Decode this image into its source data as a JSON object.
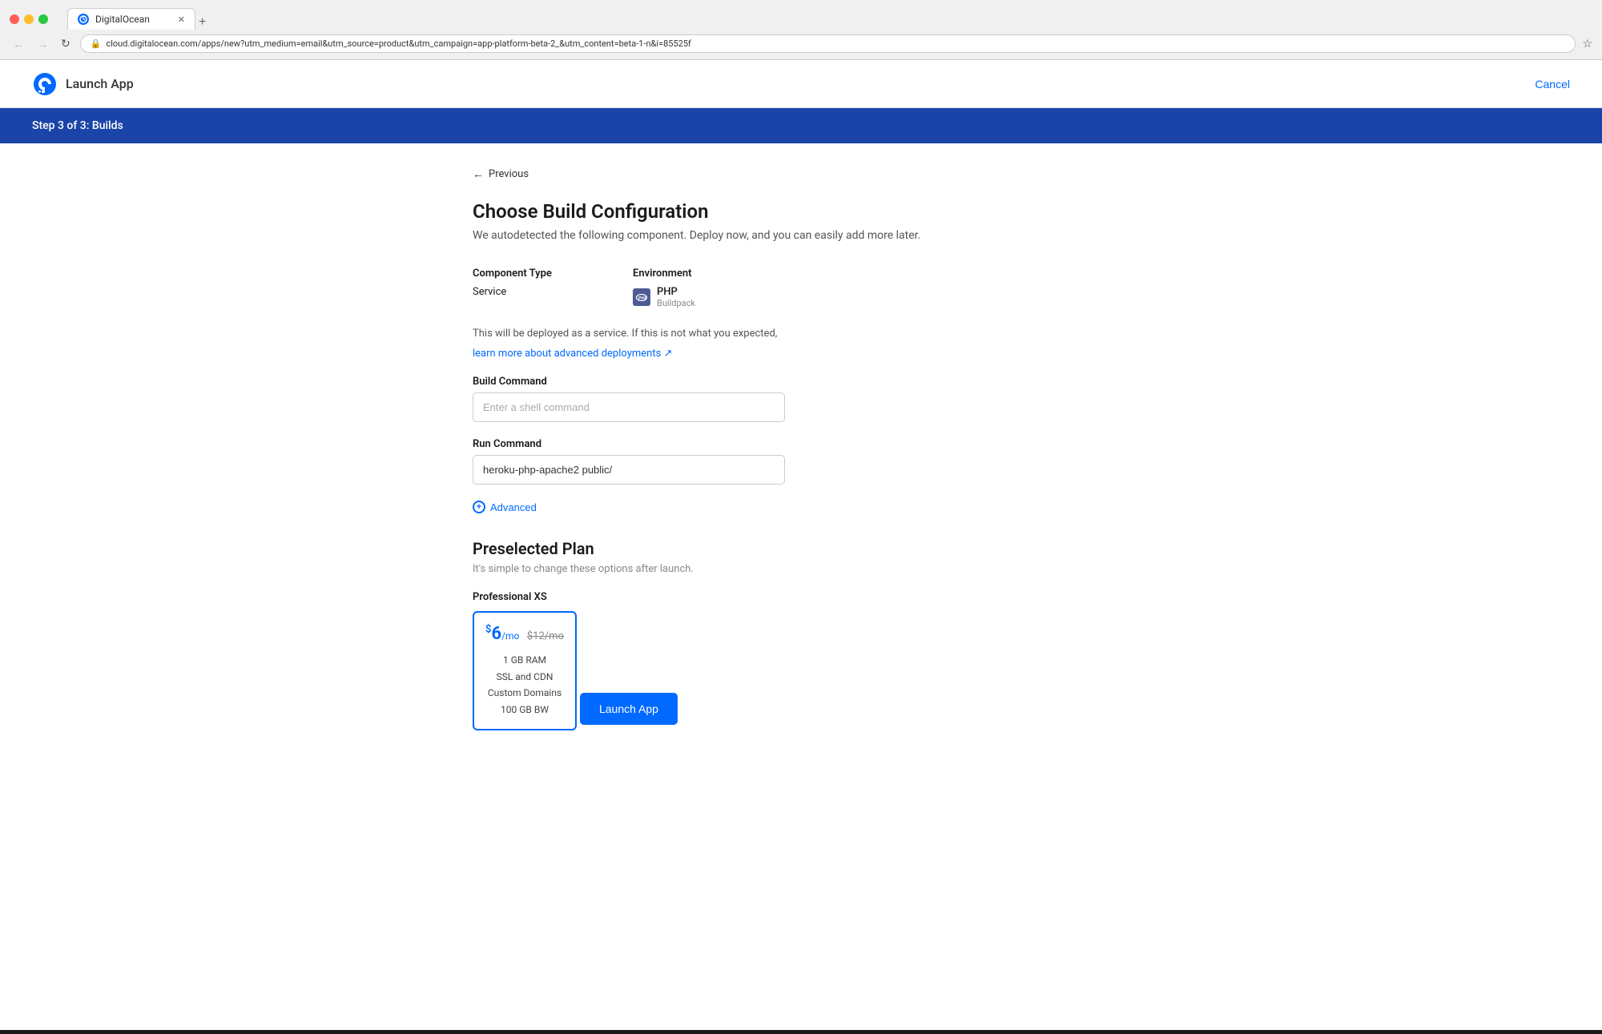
{
  "browser": {
    "tab_title": "DigitalOcean",
    "url": "cloud.digitalocean.com/apps/new?utm_medium=email&utm_source=product&utm_campaign=app-platform-beta-2_&utm_content=beta-1-n&i=85525f",
    "back_label": "←",
    "forward_label": "→",
    "reload_label": "↻",
    "new_tab_label": "+"
  },
  "app_header": {
    "title": "Launch App",
    "cancel_label": "Cancel"
  },
  "step_bar": {
    "label": "Step 3 of 3: Builds"
  },
  "back_nav": {
    "label": "Previous"
  },
  "page": {
    "title": "Choose Build Configuration",
    "subtitle": "We autodetected the following component. Deploy now, and you can easily add more later.",
    "component_type_label": "Component Type",
    "component_type_value": "Service",
    "environment_label": "Environment",
    "environment_name": "PHP",
    "environment_type": "Buildpack",
    "service_note": "This will be deployed as a service. If this is not what you expected,",
    "service_link_label": "learn more about advanced deployments ↗"
  },
  "form": {
    "build_command_label": "Build Command",
    "build_command_placeholder": "Enter a shell command",
    "run_command_label": "Run Command",
    "run_command_value": "heroku-php-apache2 public/",
    "advanced_label": "Advanced"
  },
  "plan": {
    "section_title": "Preselected Plan",
    "section_subtitle": "It's simple to change these options after launch.",
    "plan_type": "Professional XS",
    "price_current": "6",
    "price_per": "/mo",
    "price_original": "$12/mo",
    "features": [
      "1 GB RAM",
      "SSL and CDN",
      "Custom Domains",
      "100 GB BW"
    ],
    "launch_label": "Launch App"
  }
}
